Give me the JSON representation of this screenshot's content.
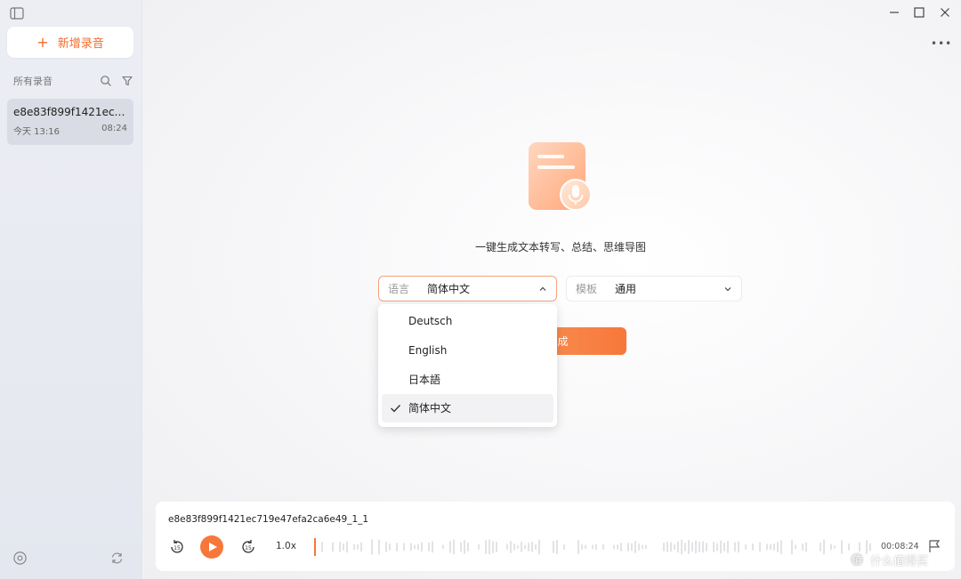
{
  "sidebar": {
    "new_recording_label": "新增录音",
    "list_header": "所有录音",
    "recordings": [
      {
        "name": "e8e83f899f1421ec7...",
        "date": "今天 13:16",
        "duration": "08:24"
      }
    ]
  },
  "main": {
    "hero_text": "一键生成文本转写、总结、思维导图",
    "language_select": {
      "label": "语言",
      "value": "简体中文"
    },
    "template_select": {
      "label": "模板",
      "value": "通用"
    },
    "generate_label": "生成",
    "language_options": [
      {
        "label": "Deutsch",
        "selected": false
      },
      {
        "label": "English",
        "selected": false
      },
      {
        "label": "日本語",
        "selected": false
      },
      {
        "label": "简体中文",
        "selected": true
      }
    ]
  },
  "player": {
    "file_name": "e8e83f899f1421ec719e47efa2ca6e49_1_1",
    "speed": "1.0x",
    "time": "00:08:24"
  },
  "watermark": "什么值得买",
  "colors": {
    "accent": "#f7773a",
    "accent_light": "#fb9a5e",
    "sidebar_bg": "#e8ebf1"
  }
}
